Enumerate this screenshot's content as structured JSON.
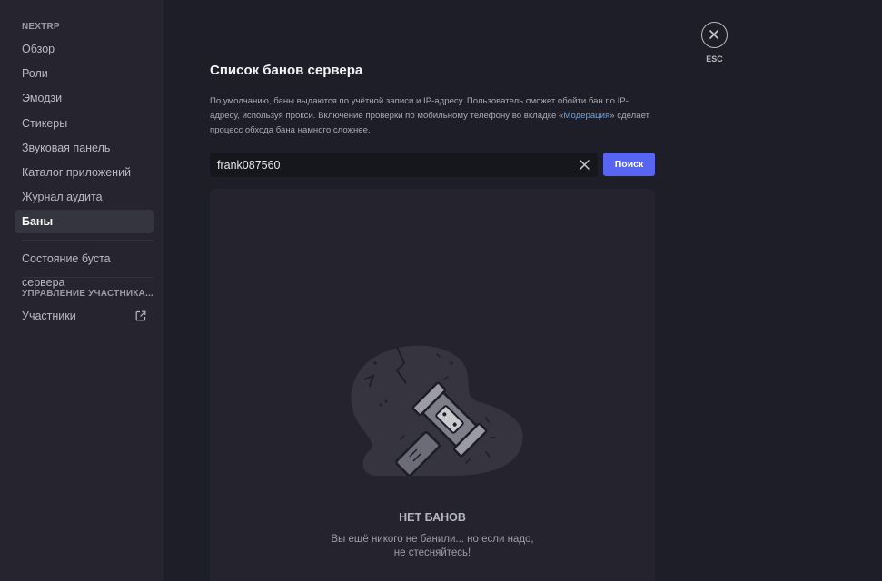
{
  "sidebar": {
    "server_header": "NEXTRP",
    "items": [
      {
        "label": "Обзор"
      },
      {
        "label": "Роли"
      },
      {
        "label": "Эмодзи"
      },
      {
        "label": "Стикеры"
      },
      {
        "label": "Звуковая панель"
      },
      {
        "label": "Каталог приложений"
      },
      {
        "label": "Журнал аудита"
      },
      {
        "label": "Баны",
        "active": true
      }
    ],
    "boost_item": "Состояние буста сервера",
    "members_header": "УПРАВЛЕНИЕ УЧАСТНИКА...",
    "members_item": "Участники",
    "members_item_icon": "external-link-icon"
  },
  "close": {
    "label": "ESC",
    "icon": "close-icon"
  },
  "page": {
    "title": "Список банов сервера",
    "description_part1": "По умолчанию, баны выдаются по учётной записи и IP-адресу. Пользователь сможет обойти бан по IP-адресу, используя прокси. Включение проверки по мобильному телефону во вкладке «",
    "description_link": "Модерация",
    "description_part2": "» сделает процесс обхода бана намного сложнее."
  },
  "search": {
    "value": "frank087560",
    "clear_icon": "clear-icon",
    "button_label": "Поиск"
  },
  "empty_state": {
    "illustration": "ban-hammer-illustration",
    "title": "НЕТ БАНОВ",
    "text_line1": "Вы ещё никого не банили... но если надо,",
    "text_line2": "не стесняйтесь!"
  },
  "colors": {
    "accent": "#5865f2",
    "link": "#5aa5ef",
    "background": "#1e1e28",
    "sidebar": "#26252f"
  }
}
